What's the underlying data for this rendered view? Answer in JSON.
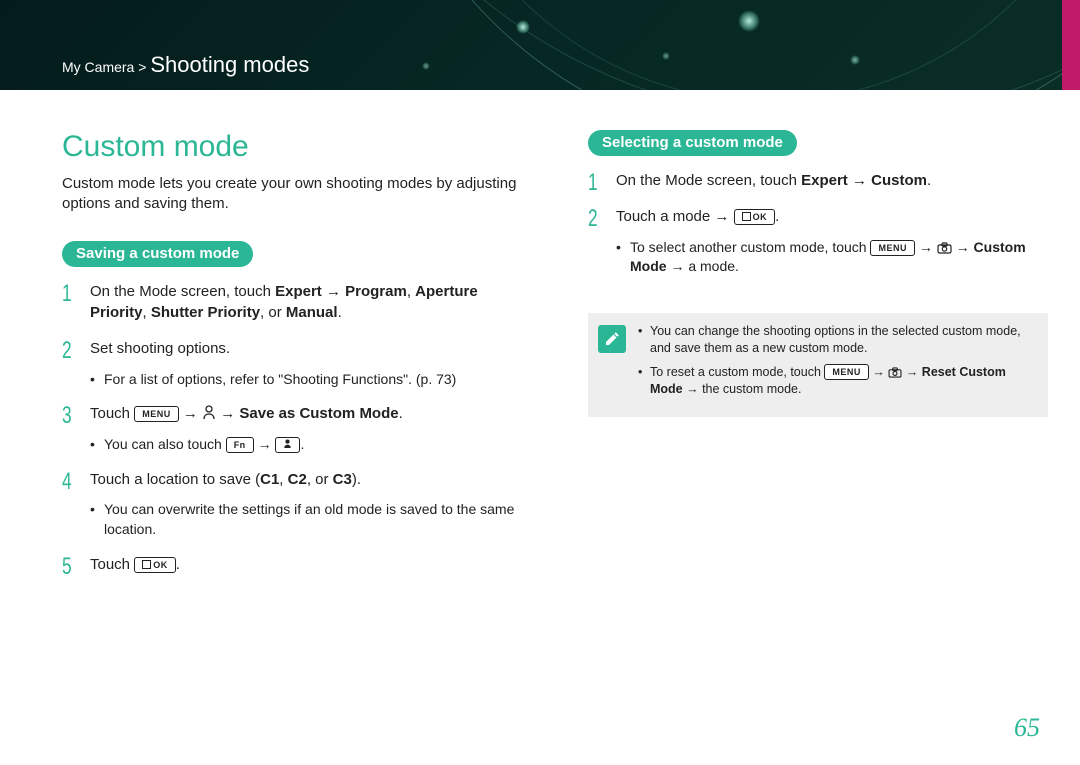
{
  "breadcrumb": {
    "section": "My Camera",
    "sep": " > ",
    "current": "Shooting modes"
  },
  "page_number": "65",
  "title": "Custom mode",
  "intro": "Custom mode lets you create your own shooting modes by adjusting options and saving them.",
  "left": {
    "heading": "Saving a custom mode",
    "step1": {
      "a": "On the Mode screen, touch ",
      "b": "Expert",
      "c": " → ",
      "d": "Program",
      "e": ", ",
      "f": "Aperture Priority",
      "g": ", ",
      "h": "Shutter Priority",
      "i": ", or ",
      "j": "Manual",
      "k": "."
    },
    "step2": {
      "text": "Set shooting options.",
      "bullet": "For a list of options, refer to \"Shooting Functions\". (p. 73)"
    },
    "step3": {
      "a": "Touch ",
      "menu_key": "MENU",
      "b": " → ",
      "c": " → ",
      "d": "Save as Custom Mode",
      "e": ".",
      "bullet_a": "You can also touch ",
      "fn_key": "Fn",
      "bullet_b": " → ",
      "bullet_c": "."
    },
    "step4": {
      "a": "Touch a location to save (",
      "b": "C1",
      "c": ", ",
      "d": "C2",
      "e": ", or ",
      "f": "C3",
      "g": ").",
      "bullet": "You can overwrite the settings if an old mode is saved to the same location."
    },
    "step5": {
      "a": "Touch ",
      "ok_key": "OK",
      "b": "."
    }
  },
  "right": {
    "heading": "Selecting a custom mode",
    "step1": {
      "a": "On the Mode screen, touch ",
      "b": "Expert",
      "c": " → ",
      "d": "Custom",
      "e": "."
    },
    "step2": {
      "a": "Touch a mode → ",
      "ok_key": "OK",
      "b": ".",
      "bullet_a": "To select another custom mode, touch ",
      "menu_key": "MENU",
      "bullet_b": " → ",
      "bullet_c": " → ",
      "bullet_d": "Custom Mode",
      "bullet_e": " → a mode."
    },
    "note1": "You can change the shooting options in the selected custom mode, and save them as a new custom mode.",
    "note2": {
      "a": "To reset a custom mode, touch ",
      "menu_key": "MENU",
      "b": " → ",
      "c": " → ",
      "d": "Reset Custom Mode",
      "e": " → the custom mode."
    }
  }
}
